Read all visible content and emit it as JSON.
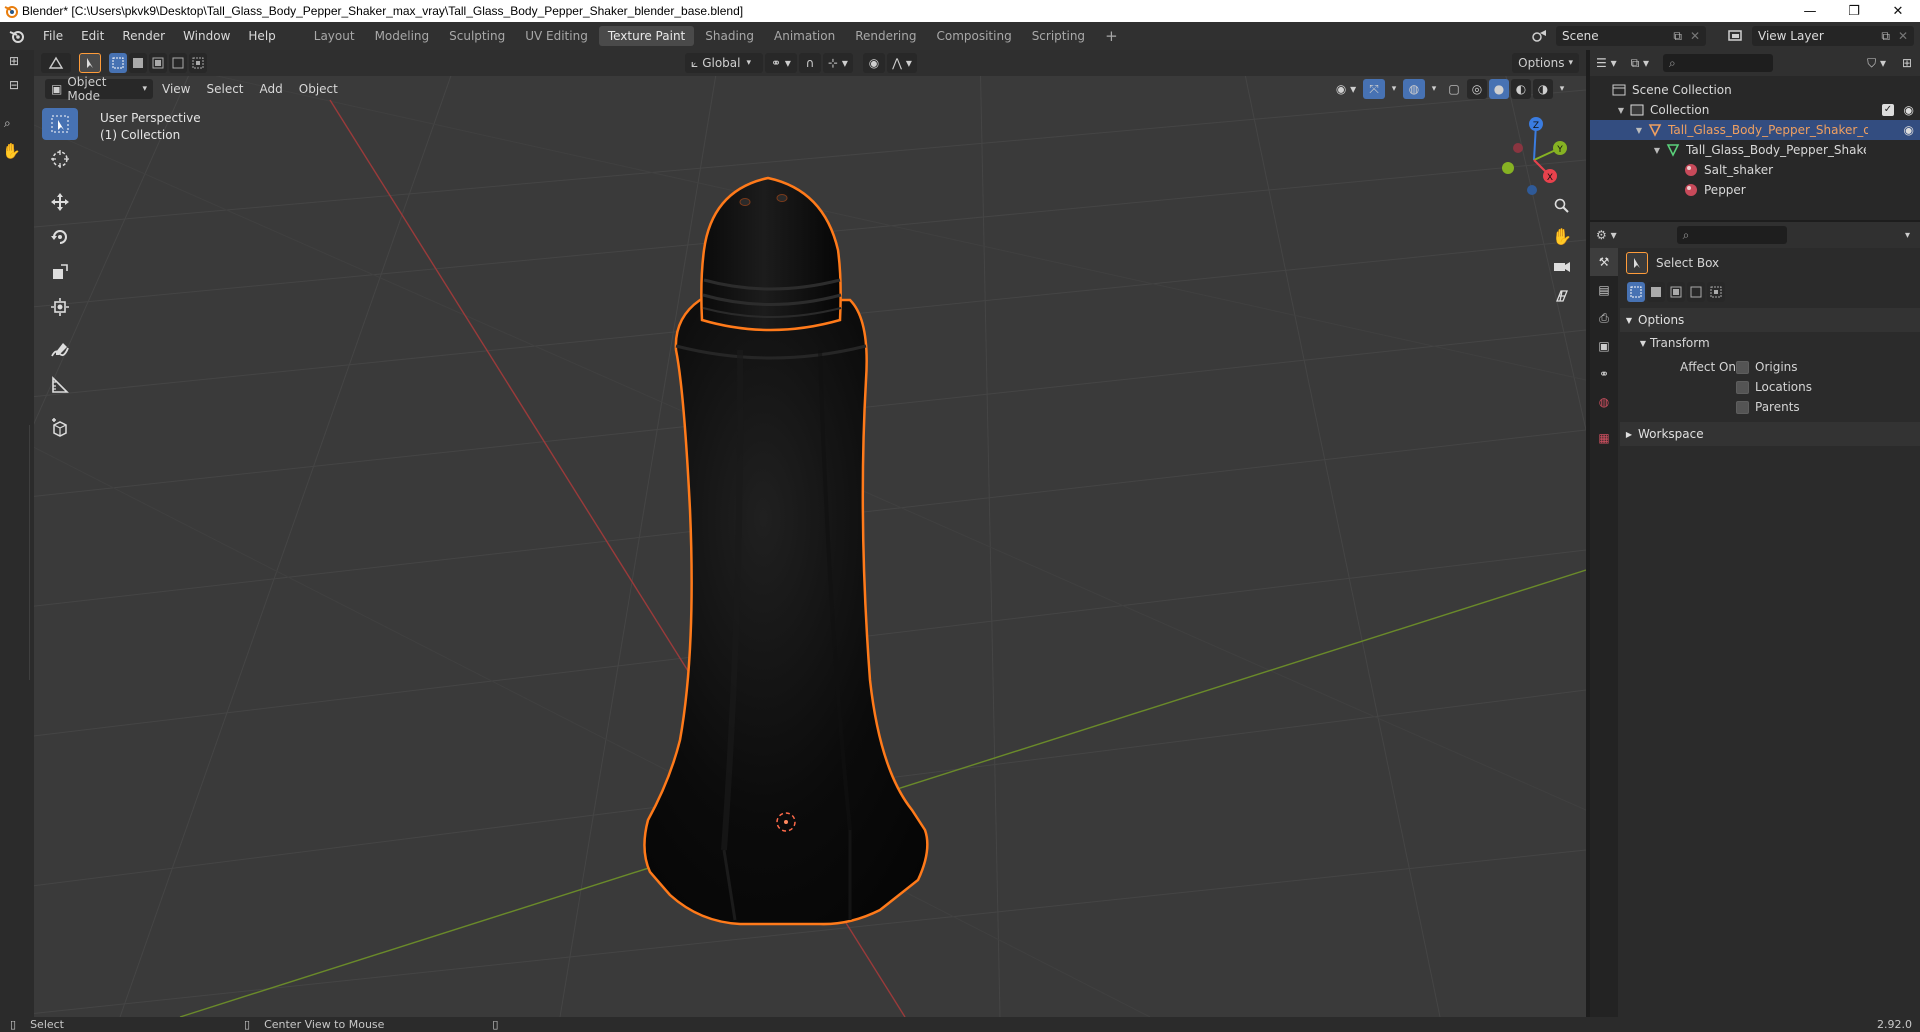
{
  "title_bar": {
    "title": "Blender* [C:\\Users\\pkvk9\\Desktop\\Tall_Glass_Body_Pepper_Shaker_max_vray\\Tall_Glass_Body_Pepper_Shaker_blender_base.blend]",
    "minimize": "—",
    "restore": "❐",
    "close": "✕"
  },
  "menu": {
    "file": "File",
    "edit": "Edit",
    "render": "Render",
    "window": "Window",
    "help": "Help"
  },
  "workspaces": [
    {
      "label": "Layout",
      "active": false
    },
    {
      "label": "Modeling",
      "active": false
    },
    {
      "label": "Sculpting",
      "active": false
    },
    {
      "label": "UV Editing",
      "active": false
    },
    {
      "label": "Texture Paint",
      "active": true
    },
    {
      "label": "Shading",
      "active": false
    },
    {
      "label": "Animation",
      "active": false
    },
    {
      "label": "Rendering",
      "active": false
    },
    {
      "label": "Compositing",
      "active": false
    },
    {
      "label": "Scripting",
      "active": false
    }
  ],
  "add_workspace": "+",
  "scene": {
    "name": "Scene",
    "view_layer": "View Layer"
  },
  "viewport": {
    "transform_orientation": "Global",
    "options_label": "Options",
    "mode": "Object Mode",
    "menus": [
      "View",
      "Select",
      "Add",
      "Object"
    ],
    "perspective": "User Perspective",
    "collection": "(1) Collection",
    "axes": {
      "x": "X",
      "y": "Y",
      "z": "Z"
    }
  },
  "outliner": {
    "scene_collection": "Scene Collection",
    "collection": "Collection",
    "object": "Tall_Glass_Body_Pepper_Shaker_obj_bas",
    "mesh": "Tall_Glass_Body_Pepper_Shaker_obj",
    "materials": [
      "Salt_shaker",
      "Pepper"
    ]
  },
  "properties": {
    "tool_name": "Select Box",
    "options": "Options",
    "transform": "Transform",
    "affect_only": "Affect Only",
    "checkboxes": [
      "Origins",
      "Locations",
      "Parents"
    ],
    "workspace": "Workspace"
  },
  "status_bar": {
    "select": "Select",
    "center_view": "Center View to Mouse",
    "version": "2.92.0"
  },
  "colors": {
    "accent": "#4772b3",
    "selection_outline": "#ff7a1a",
    "outliner_selected": "#334d80",
    "object_active_text": "#f0a060",
    "x_axis": "#e8424d",
    "y_axis": "#86b223",
    "z_axis": "#3a7ce0"
  }
}
